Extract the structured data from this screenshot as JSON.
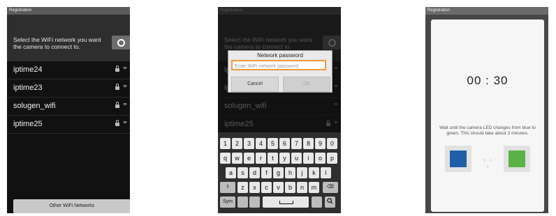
{
  "screen1": {
    "title": "Registration",
    "header_text": "Select the WiFi network you want the camera to connect to.",
    "networks": [
      "iptime24",
      "iptime23",
      "solugen_wifi",
      "iptime25"
    ],
    "other_button": "Other WiFi Networks"
  },
  "screen2": {
    "title": "Registration",
    "dialog": {
      "title": "Network password",
      "input_placeholder": "Enter WiFi network password",
      "cancel": "Cancel",
      "ok": "OK"
    },
    "keyboard": {
      "row1": [
        "1",
        "2",
        "3",
        "4",
        "5",
        "6",
        "7",
        "8",
        "9",
        "0"
      ],
      "row2": [
        "q",
        "w",
        "e",
        "r",
        "t",
        "y",
        "u",
        "i",
        "o",
        "p"
      ],
      "row3": [
        "a",
        "s",
        "d",
        "f",
        "g",
        "h",
        "j",
        "k",
        "l"
      ],
      "row4": [
        "⇧",
        "z",
        "x",
        "c",
        "v",
        "b",
        "n",
        "m",
        "⌫"
      ],
      "sym": "Sym",
      "search": "🔍"
    }
  },
  "screen3": {
    "title": "Registration",
    "timer": "00 : 30",
    "hint": "Wait until the camera LED changes from blue to green. This should take about 3 minutes.",
    "dots": "› › ›",
    "colors": {
      "start": "#1f5fa8",
      "end": "#5bb247"
    }
  }
}
